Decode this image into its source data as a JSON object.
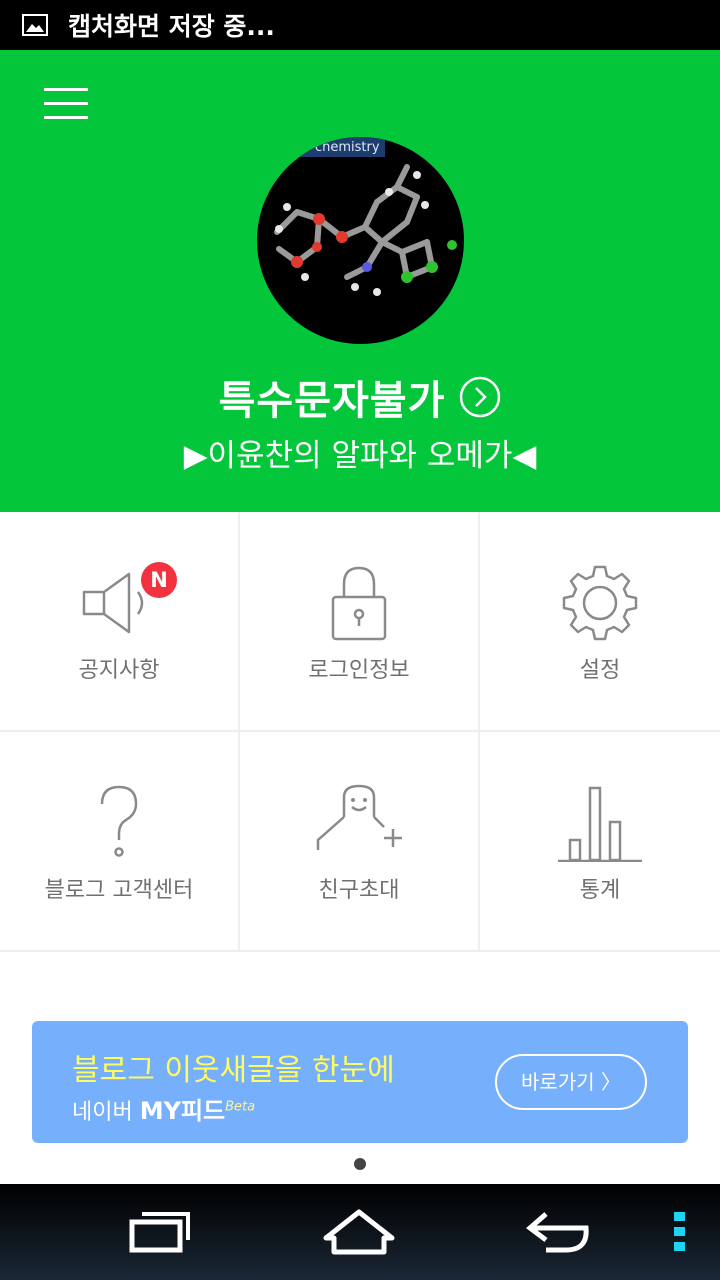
{
  "status_bar": {
    "notification_icon": "image-icon",
    "text": "캡처화면 저장 중..."
  },
  "header": {
    "background_color": "#03c63b",
    "menu_icon": "hamburger-menu-icon",
    "avatar_caption": "chemistry",
    "blog_title": "특수문자불가",
    "blog_subtitle": "▶이윤찬의 알파와 오메가◀"
  },
  "menu_grid": [
    {
      "label": "공지사항",
      "icon": "speaker-icon",
      "badge": "N"
    },
    {
      "label": "로그인정보",
      "icon": "lock-icon"
    },
    {
      "label": "설정",
      "icon": "gear-icon"
    },
    {
      "label": "블로그 고객센터",
      "icon": "question-icon"
    },
    {
      "label": "친구초대",
      "icon": "add-friend-icon"
    },
    {
      "label": "통계",
      "icon": "bar-chart-icon"
    }
  ],
  "banner": {
    "title": "블로그 이웃새글을 한눈에",
    "subtitle_prefix": "네이버 ",
    "subtitle_brand": "MY피드",
    "subtitle_beta": "Beta",
    "button_label": "바로가기 〉",
    "background_color": "#76affb",
    "title_color": "#fffb62"
  },
  "nav_bar": {
    "recent_icon": "recent-apps-icon",
    "home_icon": "home-icon",
    "back_icon": "back-icon",
    "more_icon": "more-vertical-icon"
  }
}
